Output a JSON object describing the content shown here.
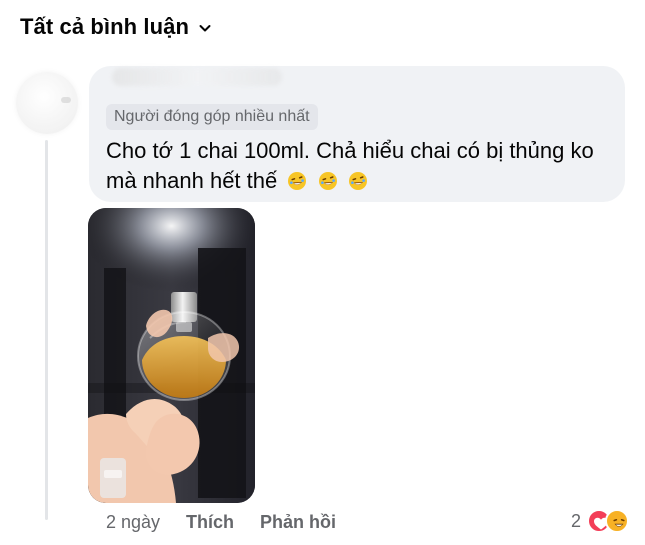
{
  "header": {
    "title": "Tất cả bình luận",
    "dropdown_icon": "chevron-down-icon"
  },
  "comment": {
    "badge": "Người đóng góp nhiều nhất",
    "text": "Cho tớ 1 chai 100ml. Chả hiểu chai có bị thủng ko mà nhanh hết thế",
    "emojis": [
      "rolling-on-floor-laughing",
      "rolling-on-floor-laughing",
      "rolling-on-floor-laughing"
    ],
    "time": "2 ngày",
    "like_label": "Thích",
    "reply_label": "Phản hồi",
    "reaction_count": "2",
    "reaction_icons": [
      "heart",
      "haha"
    ]
  },
  "colors": {
    "bubble_bg": "#f0f2f5",
    "badge_bg": "#e4e6eb",
    "meta_text": "#65676b",
    "heart": "#f33e58",
    "haha": "#f7b125"
  }
}
